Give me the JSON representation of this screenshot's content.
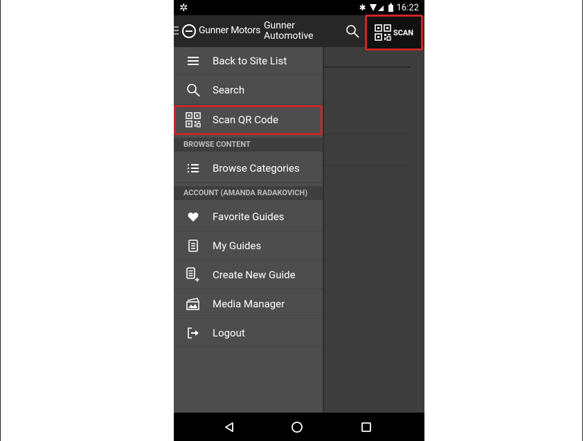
{
  "status_bar": {
    "time": "16:22",
    "icons": [
      "settings-gear-icon",
      "bluetooth-icon",
      "wifi-signal-icon",
      "battery-icon"
    ]
  },
  "app_bar": {
    "logo_text": "Gunner Motors",
    "site_name_line1": "Gunner",
    "site_name_line2": "Automotive",
    "scan_label": "SCAN"
  },
  "drawer": {
    "items": [
      {
        "label": "Back to Site List",
        "icon": "menu-lines-icon"
      },
      {
        "label": "Search",
        "icon": "search-icon"
      },
      {
        "label": "Scan QR Code",
        "icon": "qr-code-icon"
      }
    ],
    "browse_header": "BROWSE CONTENT",
    "browse_items": [
      {
        "label": "Browse Categories",
        "icon": "list-icon"
      }
    ],
    "account_header": "ACCOUNT (AMANDA RADAKOVICH)",
    "account_items": [
      {
        "label": "Favorite Guides",
        "icon": "heart-icon"
      },
      {
        "label": "My Guides",
        "icon": "document-icon"
      },
      {
        "label": "Create New Guide",
        "icon": "new-document-icon"
      },
      {
        "label": "Media Manager",
        "icon": "images-icon"
      },
      {
        "label": "Logout",
        "icon": "logout-icon"
      }
    ]
  },
  "nav_bar": {
    "buttons": [
      "back-triangle-icon",
      "home-circle-icon",
      "recents-square-icon"
    ]
  },
  "colors": {
    "highlight": "#c62828",
    "drawer_bg": "#4d4d4d",
    "app_bar_bg": "#272727"
  }
}
